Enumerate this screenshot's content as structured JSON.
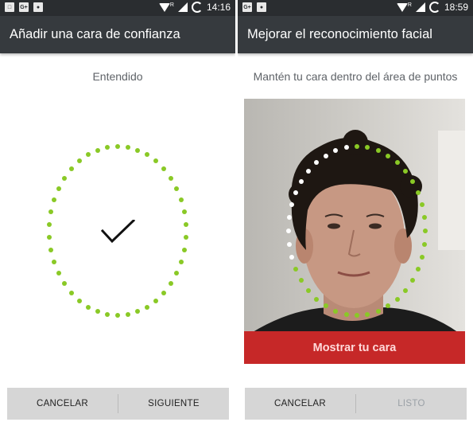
{
  "left": {
    "status": {
      "icons": [
        "image-icon",
        "gplus-icon",
        "bag-icon"
      ],
      "time": "14:16",
      "network": "R"
    },
    "title": "Añadir una cara de confianza",
    "instruction": "Entendido",
    "buttons": {
      "cancel": "CANCELAR",
      "next": "SIGUIENTE"
    }
  },
  "right": {
    "status": {
      "icons": [
        "gplus-icon",
        "bag-icon"
      ],
      "time": "18:59",
      "network": "R"
    },
    "title": "Mejorar el reconocimiento facial",
    "instruction": "Mantén tu cara dentro del área de puntos",
    "cta": "Mostrar tu cara",
    "buttons": {
      "cancel": "CANCELAR",
      "done": "LISTO"
    }
  },
  "colors": {
    "accent_green": "#8ac926",
    "cta_red": "#c62828",
    "appbar": "#363a3e",
    "statusbar": "#2a2d30"
  }
}
